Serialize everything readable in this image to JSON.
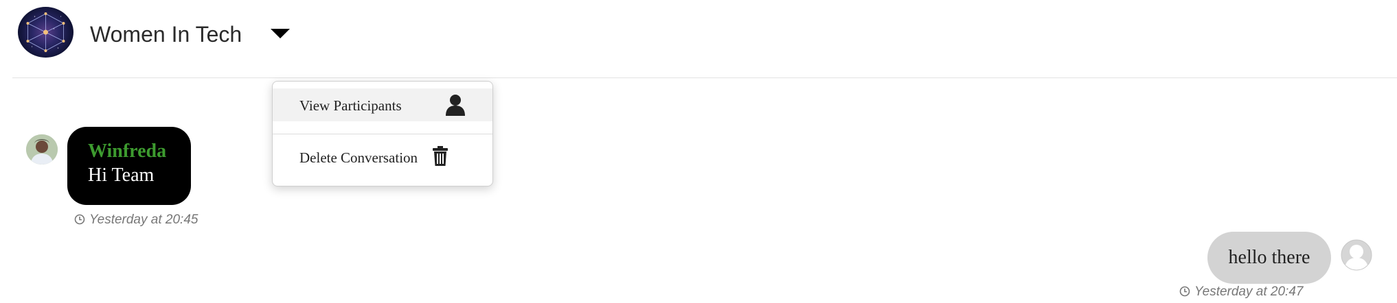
{
  "header": {
    "group_name": "Women In Tech",
    "avatar_icon": "network-icon",
    "dropdown_icon": "caret-down-icon"
  },
  "dropdown_menu": {
    "items": [
      {
        "label": "View Participants",
        "icon": "person-icon"
      },
      {
        "label": "Delete Conversation",
        "icon": "trash-icon"
      }
    ]
  },
  "messages": [
    {
      "direction": "received",
      "sender": "Winfreda",
      "text": "Hi Team",
      "timestamp": "Yesterday at 20:45",
      "bubble_color": "#000000",
      "sender_color": "#3d9b2f"
    },
    {
      "direction": "sent",
      "text": "hello there",
      "timestamp": "Yesterday at 20:47",
      "bubble_color": "#d3d3d3"
    }
  ],
  "colors": {
    "menu_hover": "#f2f2f2",
    "divider": "#e3e3e3",
    "timestamp": "#777777"
  }
}
